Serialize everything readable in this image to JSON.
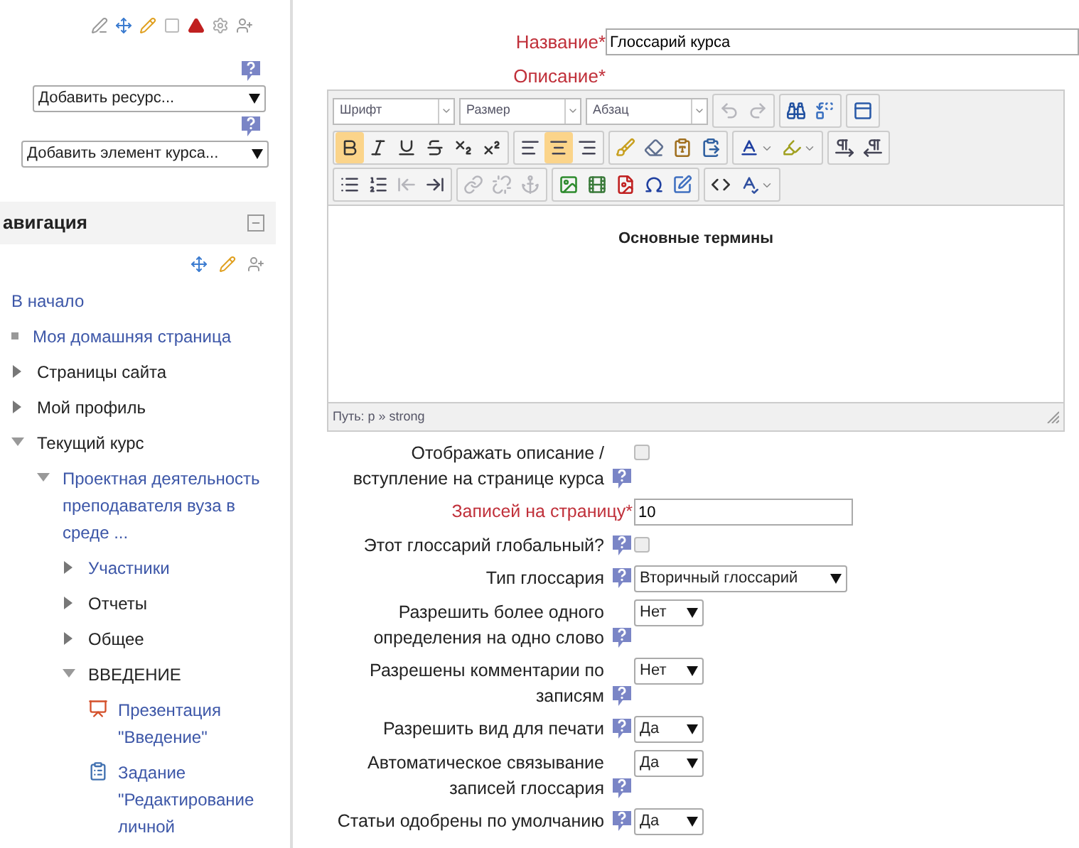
{
  "required_mark": "*",
  "sidebar": {
    "add_resource": "Добавить ресурс...",
    "add_activity": "Добавить элемент курса...",
    "navigation": {
      "title": "авигация",
      "items": [
        {
          "label": "В начало",
          "kind": "home",
          "link": true
        },
        {
          "label": "Моя домашняя страница",
          "kind": "bullet",
          "link": true
        },
        {
          "label": "Страницы сайта",
          "kind": "branch",
          "link": false,
          "expanded": false
        },
        {
          "label": "Мой профиль",
          "kind": "branch",
          "link": false,
          "expanded": false
        },
        {
          "label": "Текущий курс",
          "kind": "branch",
          "link": false,
          "expanded": true,
          "children": [
            {
              "label": "Проектная деятельность преподавателя вуза в среде ...",
              "kind": "branch",
              "link": true,
              "expanded": true,
              "children": [
                {
                  "label": "Участники",
                  "kind": "branch",
                  "link": true,
                  "expanded": false
                },
                {
                  "label": "Отчеты",
                  "kind": "branch",
                  "link": false,
                  "expanded": false
                },
                {
                  "label": "Общее",
                  "kind": "branch",
                  "link": false,
                  "expanded": false
                },
                {
                  "label": "ВВЕДЕНИЕ",
                  "kind": "branch",
                  "link": false,
                  "expanded": true,
                  "children": [
                    {
                      "label": "Презентация \"Введение\"",
                      "kind": "presentation",
                      "link": true
                    },
                    {
                      "label": "Задание \"Редактирование личной",
                      "kind": "assignment",
                      "link": true
                    }
                  ]
                }
              ]
            }
          ]
        }
      ]
    }
  },
  "form": {
    "name": {
      "label": "Название",
      "required": true,
      "value": "Глоссарий курса"
    },
    "description": {
      "label": "Описание",
      "required": true
    },
    "editor": {
      "selects": [
        "Шрифт",
        "Размер",
        "Абзац"
      ],
      "rows": [
        [
          [
            {
              "kind": "undo",
              "selected": false,
              "disabled": true
            },
            {
              "kind": "redo",
              "selected": false,
              "disabled": true
            }
          ],
          [
            {
              "kind": "find",
              "selected": false,
              "disabled": false
            },
            {
              "kind": "replace",
              "selected": false,
              "disabled": false
            }
          ],
          [
            {
              "kind": "fullscreen",
              "selected": false,
              "disabled": false
            }
          ]
        ],
        [
          [
            {
              "kind": "bold",
              "selected": true,
              "disabled": false
            },
            {
              "kind": "italic",
              "selected": false,
              "disabled": false
            },
            {
              "kind": "underline",
              "selected": false,
              "disabled": false
            },
            {
              "kind": "strike",
              "selected": false,
              "disabled": false
            },
            {
              "kind": "sub",
              "selected": false,
              "disabled": false
            },
            {
              "kind": "sup",
              "selected": false,
              "disabled": false
            }
          ],
          [
            {
              "kind": "align-left",
              "selected": false,
              "disabled": false
            },
            {
              "kind": "align-center",
              "selected": true,
              "disabled": false
            },
            {
              "kind": "align-right",
              "selected": false,
              "disabled": false
            }
          ],
          [
            {
              "kind": "clean",
              "selected": false,
              "disabled": false
            },
            {
              "kind": "eraser",
              "selected": false,
              "disabled": false
            },
            {
              "kind": "paste-text",
              "selected": false,
              "disabled": false
            },
            {
              "kind": "paste-word",
              "selected": false,
              "disabled": false
            }
          ],
          [
            {
              "kind": "text-color",
              "selected": false,
              "disabled": false
            },
            {
              "kind": "highlight",
              "selected": false,
              "disabled": false
            }
          ],
          [
            {
              "kind": "ltr",
              "selected": false,
              "disabled": false
            },
            {
              "kind": "rtl",
              "selected": false,
              "disabled": false
            }
          ]
        ],
        [
          [
            {
              "kind": "list-ul",
              "selected": false,
              "disabled": false
            },
            {
              "kind": "list-ol",
              "selected": false,
              "disabled": false
            },
            {
              "kind": "outdent",
              "selected": false,
              "disabled": true
            },
            {
              "kind": "indent",
              "selected": false,
              "disabled": false
            }
          ],
          [
            {
              "kind": "link",
              "selected": false,
              "disabled": true
            },
            {
              "kind": "unlink",
              "selected": false,
              "disabled": true
            },
            {
              "kind": "anchor",
              "selected": false,
              "disabled": true
            }
          ],
          [
            {
              "kind": "image",
              "selected": false,
              "disabled": false
            },
            {
              "kind": "media",
              "selected": false,
              "disabled": false
            },
            {
              "kind": "file",
              "selected": false,
              "disabled": false
            },
            {
              "kind": "omega",
              "selected": false,
              "disabled": false
            },
            {
              "kind": "edit",
              "selected": false,
              "disabled": false
            }
          ],
          [
            {
              "kind": "html",
              "selected": false,
              "disabled": false
            },
            {
              "kind": "spell",
              "selected": false,
              "disabled": false
            }
          ]
        ]
      ],
      "content": "Основные термины",
      "path": "Путь: p » strong"
    },
    "fields": [
      {
        "kind": "checkbox",
        "label": "Отображать описание / вступление на странице курса",
        "required": false,
        "help": true,
        "checked": false
      },
      {
        "kind": "text",
        "label": "Записей на страницу",
        "required": true,
        "help": false,
        "value": "10"
      },
      {
        "kind": "checkbox",
        "label": "Этот глоссарий глобальный?",
        "required": false,
        "help": true,
        "checked": false
      },
      {
        "kind": "select",
        "label": "Тип глоссария",
        "required": false,
        "help": true,
        "value": "Вторичный глоссарий"
      },
      {
        "kind": "select",
        "label": "Разрешить более одного определения на одно слово",
        "required": false,
        "help": true,
        "value": "Нет"
      },
      {
        "kind": "select",
        "label": "Разрешены комментарии по записям",
        "required": false,
        "help": true,
        "value": "Нет"
      },
      {
        "kind": "select",
        "label": "Разрешить вид для печати",
        "required": false,
        "help": true,
        "value": "Да"
      },
      {
        "kind": "select",
        "label": "Автоматическое связывание записей глоссария",
        "required": false,
        "help": true,
        "value": "Да"
      },
      {
        "kind": "select",
        "label": "Статьи одобрены по умолчанию",
        "required": false,
        "help": true,
        "value": "Да"
      }
    ]
  }
}
